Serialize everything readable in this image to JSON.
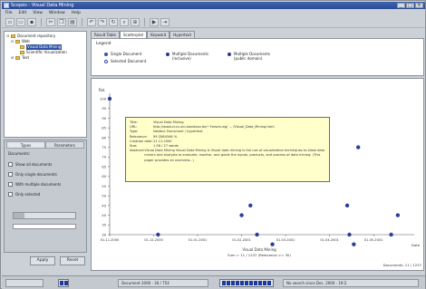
{
  "window": {
    "title": "Scopes - Visual Data Mining",
    "controls": [
      "_",
      "□",
      "×"
    ]
  },
  "menu": [
    "File",
    "Edit",
    "View",
    "Window",
    "Help"
  ],
  "toolbar": {
    "icons": [
      "new-icon",
      "open-icon",
      "save-icon",
      "cut-icon",
      "copy-icon",
      "paste-icon",
      "undo-icon",
      "redo-icon",
      "refresh-icon",
      "search-icon",
      "zoom-icon",
      "play-icon",
      "forward-icon"
    ]
  },
  "tree": {
    "items": [
      {
        "label": "Document repository",
        "depth": 0,
        "expanded": true
      },
      {
        "label": "Web",
        "depth": 1,
        "expanded": true
      },
      {
        "label": "Visual Data Mining",
        "depth": 2,
        "selected": true
      },
      {
        "label": "Scientific Visualization",
        "depth": 2
      },
      {
        "label": "Text",
        "depth": 1
      }
    ]
  },
  "filter": {
    "tabs": [
      "Types",
      "Parameters"
    ],
    "title": "Documents:",
    "options": [
      "Show all documents",
      "Only single documents",
      "With multiple documents",
      "Only selected"
    ],
    "apply_label": "Apply",
    "reset_label": "Reset"
  },
  "tabs": [
    "Result Table",
    "Scatterplot",
    "Keyword",
    "Hypertext"
  ],
  "legend": {
    "title": "Legend",
    "items": [
      {
        "label": "Single Document",
        "color": "#3b4fb0"
      },
      {
        "label": "Selected Document",
        "color": "#3b4fb0"
      },
      {
        "label": "Multiple Documents",
        "sub": "(inclusive)",
        "color": "#2a3a8a"
      },
      {
        "label": "Multiple Documents",
        "sub": "(public domain)",
        "color": "#2a3a8a"
      }
    ]
  },
  "chart_data": {
    "type": "scatter",
    "xlabel": "Visual Data Mining",
    "xlabel2": "Sum = 11 / 1237 (Relevance >= 30)",
    "ylabel": "Rel.",
    "x_ticks": [
      "01.11.2000",
      "01.12.2000",
      "01.01.2001",
      "01.02.2001",
      "01.03.2001",
      "01.04.2001",
      "01.05.2001"
    ],
    "y_ticks": [
      "100",
      "95",
      "90",
      "85",
      "80",
      "75",
      "70",
      "65",
      "60",
      "55",
      "50",
      "45",
      "40",
      "35",
      "30"
    ],
    "x_end_label": "Date",
    "ylim": [
      30,
      100
    ],
    "xlim": [
      0,
      6.8
    ],
    "points": [
      {
        "x": 0.0,
        "y": 100
      },
      {
        "x": 1.1,
        "y": 30
      },
      {
        "x": 3.0,
        "y": 40
      },
      {
        "x": 3.2,
        "y": 45
      },
      {
        "x": 3.35,
        "y": 30
      },
      {
        "x": 3.7,
        "y": 25
      },
      {
        "x": 5.4,
        "y": 45
      },
      {
        "x": 5.45,
        "y": 30
      },
      {
        "x": 5.55,
        "y": 25
      },
      {
        "x": 5.65,
        "y": 75
      },
      {
        "x": 6.4,
        "y": 30
      },
      {
        "x": 6.55,
        "y": 40
      }
    ],
    "footer": "Documents: 11 / 1237"
  },
  "tooltip": {
    "rows": [
      {
        "key": "Title:",
        "val": "Visual Data Mining"
      },
      {
        "key": "URL:",
        "val": "http://www.vi.cs.uni-konstanz.de/~Forschung/ ... /Visual_Data_Mining.html"
      },
      {
        "key": "Type:",
        "val": "Nested: Document / hypertext"
      },
      {
        "key": "Relevance:",
        "val": "99.3564346 %"
      },
      {
        "key": "Creation date:",
        "val": "11.11.2000"
      },
      {
        "key": "Size:",
        "val": "1.58 / 27 words"
      },
      {
        "key": "Abstract:",
        "val": "Visual Data Mining Visual Data Mining is Visual data mining is the use of visualization techniques to allow data miners and analysts to evaluate, monitor, and guide the inputs, products, and process of data mining. (This paper provides an overview...)"
      }
    ]
  },
  "status": {
    "left": "",
    "mid": "Document 2000 - 30 / 754",
    "right": "No search since Dec. 2000 - 19:2"
  }
}
